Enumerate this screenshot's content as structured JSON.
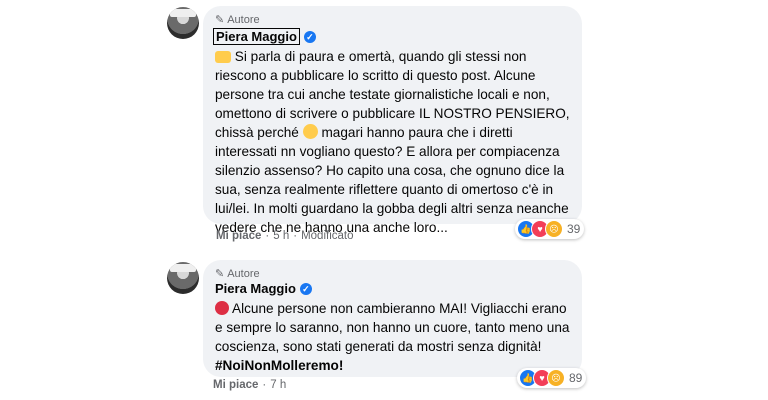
{
  "comments": [
    {
      "author_tag": "Autore",
      "name": "Piera Maggio",
      "text_prefix": "Si parla di paura e omertà, quando gli stessi non riescono a pubblicare lo scritto di questo post. Alcune persone tra cui anche testate giornalistiche locali e non, omettono di scrivere o pubblicare IL NOSTRO PENSIERO, chissà perché",
      "text_suffix": "magari hanno paura che i diretti interessati nn vogliano questo? E allora per compiacenza silenzio assenso? Ho capito una cosa, che ognuno dice la sua, senza realmente riflettere quanto di omertoso c'è in lui/lei. In molti guardano la gobba degli altri senza neanche vedere che ne hanno una anche loro...",
      "like_label": "Mi piace",
      "time": "5 h",
      "edited": "Modificato",
      "reaction_count": "39",
      "reactions": [
        "like-icon",
        "love-icon",
        "sad-icon"
      ]
    },
    {
      "author_tag": "Autore",
      "name": "Piera Maggio",
      "text": "Alcune persone non cambieranno MAI! Vigliacchi erano e sempre lo saranno, non hanno un cuore, tanto meno una coscienza, sono stati generati da mostri senza dignità!",
      "hashtag": "#NoiNonMolleremo!",
      "like_label": "Mi piace",
      "time": "7 h",
      "reaction_count": "89",
      "reactions": [
        "like-icon",
        "love-icon",
        "sad-icon"
      ]
    }
  ],
  "separator": "·"
}
